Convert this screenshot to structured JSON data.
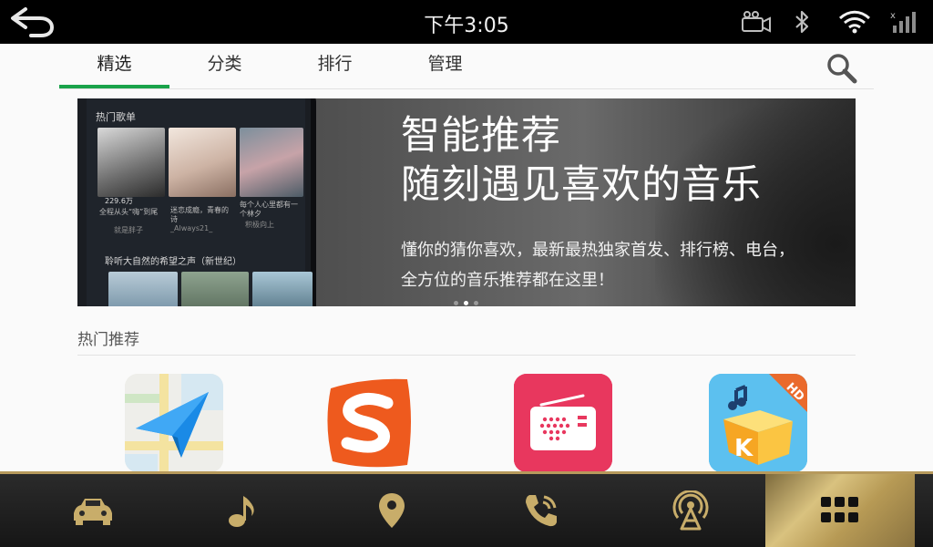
{
  "status_bar": {
    "time": "下午3:05",
    "icons": [
      "back-arrow-icon",
      "camera-icon",
      "bluetooth-icon",
      "wifi-icon",
      "signal-icon"
    ]
  },
  "tabs": [
    {
      "label": "精选",
      "active": true
    },
    {
      "label": "分类",
      "active": false
    },
    {
      "label": "排行",
      "active": false
    },
    {
      "label": "管理",
      "active": false
    }
  ],
  "banner": {
    "title_line1": "智能推荐",
    "title_line2": "随刻遇见喜欢的音乐",
    "subtitle": "懂你的猜你喜欢，最新最热独家首发、排行榜、电台，全方位的音乐推荐都在这里！",
    "phone": {
      "section1": "热门歌单",
      "count": "229.6万",
      "cap1": "全程从头“嗨”到尾",
      "cap1_author": "就是胖子",
      "cap2": "迷恋成瘾，青春的诗",
      "cap2_author": "_Always21_",
      "cap3": "每个人心里都有一个林夕",
      "cap3_author": "积极向上",
      "section2": "聆听大自然的希望之声（新世纪）"
    },
    "dots": 3,
    "active_dot": 1
  },
  "section": {
    "title": "热门推荐"
  },
  "apps": [
    {
      "name": "navigation-app",
      "icon": "paper-plane-map-icon"
    },
    {
      "name": "sogou-input-app",
      "icon": "sogou-s-icon"
    },
    {
      "name": "radio-app",
      "icon": "radio-icon"
    },
    {
      "name": "kuwo-music-hd-app",
      "icon": "kuwo-k-box-icon",
      "badge": "HD"
    }
  ],
  "dock": [
    {
      "name": "car",
      "icon": "car-icon"
    },
    {
      "name": "music",
      "icon": "music-note-icon"
    },
    {
      "name": "navigation",
      "icon": "location-pin-icon"
    },
    {
      "name": "phone",
      "icon": "phone-icon"
    },
    {
      "name": "radio",
      "icon": "antenna-icon"
    },
    {
      "name": "apps",
      "icon": "app-grid-icon",
      "active": true
    }
  ],
  "colors": {
    "accent_green": "#1aa34a",
    "dock_gold": "#c8ad6a",
    "status_bar": "#000000"
  }
}
